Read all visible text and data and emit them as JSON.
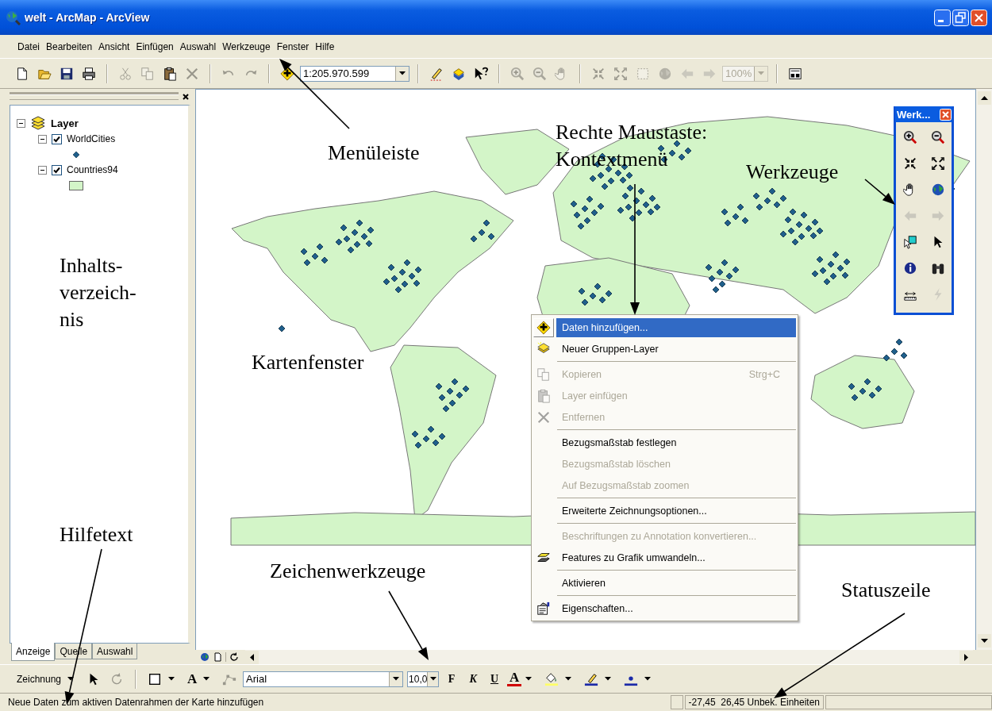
{
  "window": {
    "title": "welt - ArcMap - ArcView"
  },
  "menu_bar": [
    "Datei",
    "Bearbeiten",
    "Ansicht",
    "Einfügen",
    "Auswahl",
    "Werkzeuge",
    "Fenster",
    "Hilfe"
  ],
  "toolbar": [
    {
      "kind": "new",
      "disabled": false
    },
    {
      "kind": "open",
      "disabled": false
    },
    {
      "kind": "save",
      "disabled": false
    },
    {
      "kind": "print",
      "disabled": false
    },
    {
      "kind": "separator"
    },
    {
      "kind": "cut",
      "disabled": true
    },
    {
      "kind": "copy",
      "disabled": true
    },
    {
      "kind": "paste",
      "disabled": false
    },
    {
      "kind": "delete",
      "disabled": true
    },
    {
      "kind": "separator"
    },
    {
      "kind": "undo",
      "disabled": true
    },
    {
      "kind": "redo",
      "disabled": true
    },
    {
      "kind": "separator"
    },
    {
      "kind": "add-data",
      "disabled": false
    },
    {
      "kind": "scale-combo",
      "value": "1:205.970.599",
      "disabled": false
    },
    {
      "kind": "separator"
    },
    {
      "kind": "editor",
      "disabled": false
    },
    {
      "kind": "toolbox",
      "disabled": false
    },
    {
      "kind": "help",
      "disabled": false
    },
    {
      "kind": "separator"
    },
    {
      "kind": "zoom-in",
      "disabled": true
    },
    {
      "kind": "zoom-out",
      "disabled": true
    },
    {
      "kind": "pan",
      "disabled": true
    },
    {
      "kind": "separator"
    },
    {
      "kind": "fixed-in",
      "disabled": true
    },
    {
      "kind": "fixed-out",
      "disabled": true
    },
    {
      "kind": "actual-size",
      "disabled": true
    },
    {
      "kind": "full-extent",
      "disabled": true
    },
    {
      "kind": "back",
      "disabled": true
    },
    {
      "kind": "forward",
      "disabled": true
    },
    {
      "kind": "zoom-combo",
      "value": "100%",
      "disabled": true
    },
    {
      "kind": "separator"
    },
    {
      "kind": "layout",
      "disabled": false
    }
  ],
  "toc": {
    "layers": {
      "label": "Layer",
      "expanded": true,
      "children": [
        {
          "label": "WorldCities",
          "checked": true,
          "expanded": true,
          "kind": "point"
        },
        {
          "label": "Countries94",
          "checked": true,
          "expanded": true,
          "kind": "polygon"
        }
      ]
    },
    "tabs": [
      {
        "label": "Anzeige",
        "selected": true
      },
      {
        "label": "Quelle",
        "selected": false
      },
      {
        "label": "Auswahl",
        "selected": false
      }
    ]
  },
  "tools_window": {
    "title": "Werk...",
    "tools": [
      {
        "kind": "zoom-in",
        "disabled": false
      },
      {
        "kind": "zoom-out",
        "disabled": false
      },
      {
        "kind": "fixed-in",
        "disabled": false
      },
      {
        "kind": "fixed-out",
        "disabled": false
      },
      {
        "kind": "pan",
        "disabled": false
      },
      {
        "kind": "full-extent",
        "disabled": false
      },
      {
        "kind": "back",
        "disabled": true
      },
      {
        "kind": "forward",
        "disabled": true
      },
      {
        "kind": "select-features",
        "disabled": false
      },
      {
        "kind": "select",
        "disabled": false
      },
      {
        "kind": "identify",
        "disabled": false
      },
      {
        "kind": "find",
        "disabled": false
      },
      {
        "kind": "measure",
        "disabled": false
      },
      {
        "kind": "hyperlink",
        "disabled": true
      }
    ]
  },
  "context_menu": [
    {
      "kind": "add-data",
      "label": "Daten hinzufügen...",
      "disabled": false,
      "selected": true
    },
    {
      "kind": "group-layer",
      "label": "Neuer Gruppen-Layer",
      "disabled": false,
      "selected": false
    },
    {
      "kind": "separator"
    },
    {
      "kind": "copy",
      "label": "Kopieren",
      "shortcut": "Strg+C",
      "disabled": true,
      "selected": false
    },
    {
      "kind": "paste",
      "label": "Layer einfügen",
      "disabled": true,
      "selected": false
    },
    {
      "kind": "delete",
      "label": "Entfernen",
      "disabled": true,
      "selected": false
    },
    {
      "kind": "separator"
    },
    {
      "kind": "plain",
      "label": "Bezugsmaßstab festlegen",
      "disabled": false,
      "selected": false
    },
    {
      "kind": "plain",
      "label": "Bezugsmaßstab löschen",
      "disabled": true,
      "selected": false
    },
    {
      "kind": "plain",
      "label": "Auf Bezugsmaßstab zoomen",
      "disabled": true,
      "selected": false
    },
    {
      "kind": "separator"
    },
    {
      "kind": "plain",
      "label": "Erweiterte Zeichnungsoptionen...",
      "disabled": false,
      "selected": false
    },
    {
      "kind": "separator"
    },
    {
      "kind": "plain",
      "label": "Beschriftungen zu Annotation konvertieren...",
      "disabled": true,
      "selected": false
    },
    {
      "kind": "features",
      "label": "Features zu Grafik umwandeln...",
      "disabled": false,
      "selected": false
    },
    {
      "kind": "separator"
    },
    {
      "kind": "plain",
      "label": "Aktivieren",
      "disabled": false,
      "selected": false
    },
    {
      "kind": "separator"
    },
    {
      "kind": "properties",
      "label": "Eigenschaften...",
      "disabled": false,
      "selected": false
    }
  ],
  "drawing_toolbar": [
    {
      "kind": "menu",
      "label": "Zeichnung",
      "disabled": false
    },
    {
      "kind": "select",
      "disabled": false
    },
    {
      "kind": "rotate",
      "disabled": true
    },
    {
      "kind": "separator"
    },
    {
      "kind": "rectangle",
      "disabled": false
    },
    {
      "kind": "text",
      "label": "A",
      "disabled": false
    },
    {
      "kind": "edit-vertices",
      "disabled": true
    },
    {
      "kind": "font",
      "value": "Arial",
      "disabled": false
    },
    {
      "kind": "size",
      "value": "10,0",
      "disabled": false
    },
    {
      "kind": "bold",
      "label": "F",
      "disabled": false
    },
    {
      "kind": "italic",
      "label": "K",
      "disabled": false
    },
    {
      "kind": "underline",
      "label": "U",
      "disabled": false
    },
    {
      "kind": "font-color",
      "label": "A",
      "disabled": false
    },
    {
      "kind": "fill-color",
      "disabled": false
    },
    {
      "kind": "line-color",
      "disabled": false
    },
    {
      "kind": "marker-color",
      "disabled": false
    }
  ],
  "status_bar": {
    "help_text": "Neue Daten zum aktiven Datenrahmen der Karte hinzufügen",
    "coordinates": "-27,45  26,45 Unbek. Einheiten"
  },
  "annotations": [
    {
      "lines": [
        "Menüleiste"
      ]
    },
    {
      "lines": [
        "Rechte Maustaste:",
        "Kontextmenü"
      ]
    },
    {
      "lines": [
        "Werkzeuge"
      ]
    },
    {
      "lines": [
        "Inhalts-",
        "verzeich-",
        "nis"
      ]
    },
    {
      "lines": [
        "Kartenfenster"
      ]
    },
    {
      "lines": [
        "Hilfetext"
      ]
    },
    {
      "lines": [
        "Zeichenwerkzeuge"
      ]
    },
    {
      "lines": [
        "Statuszeile"
      ]
    }
  ]
}
